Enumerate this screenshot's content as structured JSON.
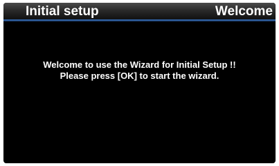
{
  "header": {
    "title": "Initial setup",
    "page": "Welcome"
  },
  "main": {
    "line1": "Welcome to use the Wizard for Initial Setup !!",
    "line2": "Please press [OK] to start the wizard."
  },
  "colors": {
    "background": "#000000",
    "text": "#ffffff",
    "accent_line": "#2f5f9f"
  }
}
